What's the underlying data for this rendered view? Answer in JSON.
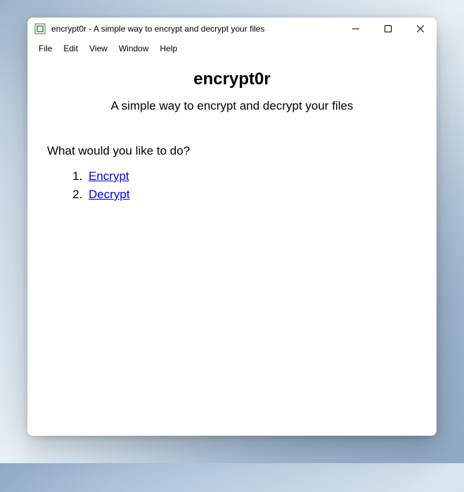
{
  "titlebar": {
    "title": "encrypt0r - A simple way to encrypt and decrypt your files"
  },
  "menubar": {
    "items": [
      "File",
      "Edit",
      "View",
      "Window",
      "Help"
    ]
  },
  "content": {
    "heading": "encrypt0r",
    "subtitle": "A simple way to encrypt and decrypt your files",
    "prompt": "What would you like to do?",
    "options": [
      {
        "label": "Encrypt"
      },
      {
        "label": "Decrypt"
      }
    ]
  }
}
